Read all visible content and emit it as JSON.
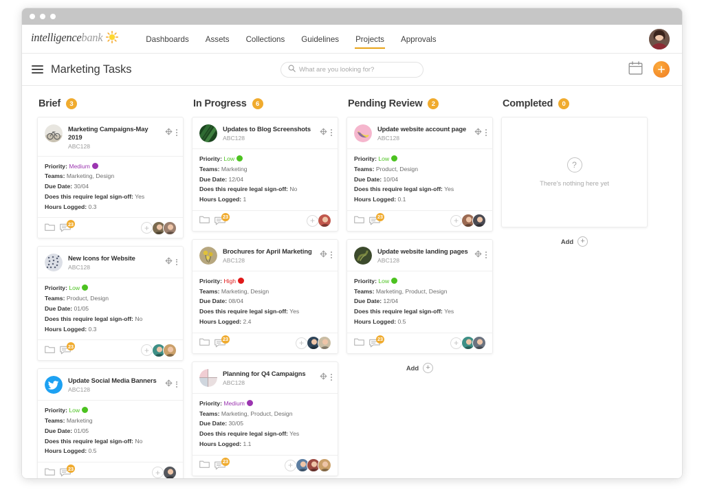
{
  "window": {
    "dots": 3
  },
  "nav": {
    "logo_part1": "intelligence",
    "logo_part2": "bank",
    "logo_icon": "sun-icon",
    "links": [
      {
        "label": "Dashboards",
        "active": false
      },
      {
        "label": "Assets",
        "active": false
      },
      {
        "label": "Collections",
        "active": false
      },
      {
        "label": "Guidelines",
        "active": false
      },
      {
        "label": "Projects",
        "active": true
      },
      {
        "label": "Approvals",
        "active": false
      }
    ],
    "active_underline_color": "#e8a317",
    "avatar": "user-avatar"
  },
  "toolbar": {
    "menu_icon": "hamburger-icon",
    "title": "Marketing Tasks",
    "search_placeholder": "What are you looking for?",
    "search_value": "",
    "search_icon": "search-icon",
    "calendar_icon": "calendar-icon",
    "add_icon": "plus-icon",
    "add_button_color": "#f2901f"
  },
  "labels": {
    "priority": "Priority:",
    "teams": "Teams:",
    "due_date": "Due Date:",
    "legal": "Does this require legal sign-off:",
    "hours": "Hours Logged:",
    "add": "Add",
    "empty_text": "There's nothing here yet",
    "question_glyph": "?",
    "plus_glyph": "+"
  },
  "priority_colors": {
    "Low": "#4cc220",
    "Medium": "#9b35b0",
    "High": "#e01919"
  },
  "priority_text_colors": {
    "Low": "#4cc220",
    "Medium": "#9b35b0",
    "High": "#e01919"
  },
  "columns": [
    {
      "title": "Brief",
      "count": "3",
      "show_add": false,
      "cards": [
        {
          "title": "Marketing Campaigns-May 2019",
          "code": "ABC128",
          "thumb": "bicycle-photo-thumbnail",
          "thumb_c1": "#e8e6e0",
          "thumb_c2": "#b9b2a4",
          "priority": "Medium",
          "teams": "Marketing, Design",
          "due_date": "30/04",
          "legal": "Yes",
          "hours": "0.3",
          "comments": "23",
          "avatars": [
            "#7a6a4f",
            "#9b7f6e"
          ]
        },
        {
          "title": "New Icons for Website",
          "code": "ABC128",
          "thumb": "icons-pattern-thumbnail",
          "thumb_c1": "#dcdfe6",
          "thumb_c2": "#9aa3b4",
          "priority": "Low",
          "teams": "Product, Design",
          "due_date": "01/05",
          "legal": "No",
          "hours": "0.3",
          "comments": "23",
          "avatars": [
            "#3e8f86",
            "#caa06a"
          ]
        },
        {
          "title": "Update Social Media Banners",
          "code": "ABC128",
          "thumb": "twitter-icon",
          "thumb_c1": "#1da1f2",
          "thumb_c2": "#1da1f2",
          "priority": "Low",
          "teams": "Marketing",
          "due_date": "01/05",
          "legal": "No",
          "hours": "0.5",
          "comments": "23",
          "avatars": [
            "#55585e"
          ]
        }
      ]
    },
    {
      "title": "In Progress",
      "count": "6",
      "show_add": false,
      "cards": [
        {
          "title": "Updates to Blog Screenshots",
          "code": "ABC128",
          "thumb": "green-leaf-thumbnail",
          "thumb_c1": "#2f6b33",
          "thumb_c2": "#1c4620",
          "priority": "Low",
          "teams": "Marketing",
          "due_date": "12/04",
          "legal": "No",
          "hours": "1",
          "comments": "23",
          "avatars": [
            "#c0574c"
          ]
        },
        {
          "title": "Brochures for April Marketing",
          "code": "ABC128",
          "thumb": "yellow-flowers-thumbnail",
          "thumb_c1": "#b7a77f",
          "thumb_c2": "#e0c23a",
          "priority": "High",
          "teams": "Marketing, Design",
          "due_date": "08/04",
          "legal": "Yes",
          "hours": "2.4",
          "comments": "23",
          "avatars": [
            "#2f4559",
            "#c9bda4"
          ]
        },
        {
          "title": "Planning for Q4 Campaigns",
          "code": "ABC128",
          "thumb": "pink-grid-thumbnail",
          "thumb_c1": "#f0cdd3",
          "thumb_c2": "#cfd6de",
          "priority": "Medium",
          "teams": "Marketing, Product, Design",
          "due_date": "30/05",
          "legal": "Yes",
          "hours": "1.1",
          "comments": "23",
          "avatars": [
            "#5c7ea1",
            "#9c4b42",
            "#caa06a"
          ]
        }
      ]
    },
    {
      "title": "Pending Review",
      "count": "2",
      "show_add": true,
      "cards": [
        {
          "title": "Update website account page",
          "code": "ABC128",
          "thumb": "pink-banana-thumbnail",
          "thumb_c1": "#f5b6cd",
          "thumb_c2": "#efd34a",
          "priority": "Low",
          "teams": "Product, Design",
          "due_date": "10/04",
          "legal": "Yes",
          "hours": "0.1",
          "comments": "23",
          "avatars": [
            "#9b6a52",
            "#4a4a52"
          ]
        },
        {
          "title": "Update website landing pages",
          "code": "ABC128",
          "thumb": "dark-green-snake-thumbnail",
          "thumb_c1": "#3c4a2c",
          "thumb_c2": "#76833f",
          "priority": "Low",
          "teams": "Marketing, Product, Design",
          "due_date": "12/04",
          "legal": "Yes",
          "hours": "0.5",
          "comments": "23",
          "avatars": [
            "#3e8f86",
            "#6b7380"
          ]
        }
      ]
    },
    {
      "title": "Completed",
      "count": "0",
      "show_add": true,
      "empty": true,
      "cards": []
    }
  ]
}
